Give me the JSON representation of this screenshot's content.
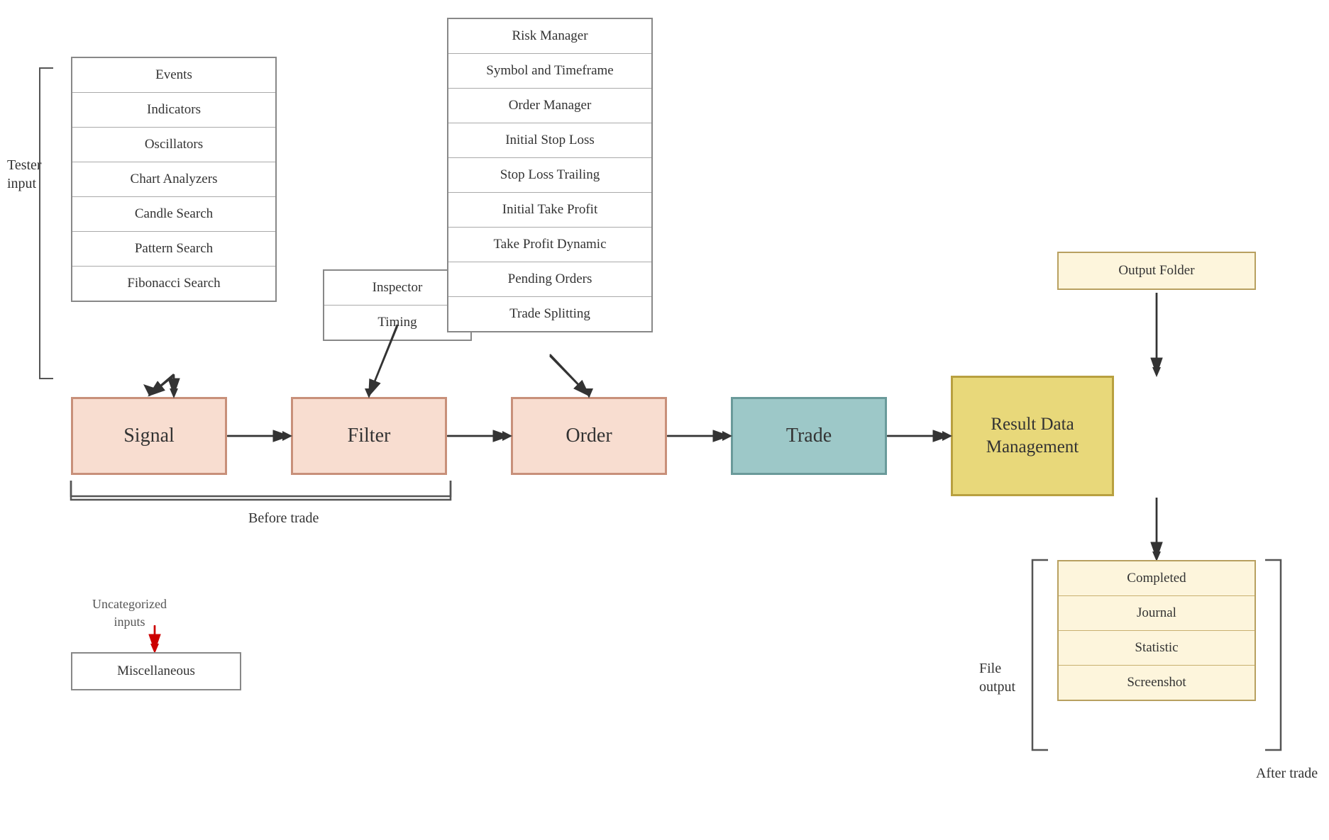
{
  "tester": {
    "label_line1": "Tester",
    "label_line2": "input"
  },
  "input_items": [
    "Events",
    "Indicators",
    "Oscillators",
    "Chart Analyzers",
    "Candle Search",
    "Pattern Search",
    "Fibonacci Search"
  ],
  "filter_items": [
    "Inspector",
    "Timing"
  ],
  "order_items": [
    "Risk Manager",
    "Symbol and Timeframe",
    "Order Manager",
    "Initial Stop Loss",
    "Stop Loss Trailing",
    "Initial Take Profit",
    "Take Profit Dynamic",
    "Pending Orders",
    "Trade Splitting"
  ],
  "process": {
    "signal": "Signal",
    "filter": "Filter",
    "order": "Order",
    "trade": "Trade",
    "rdm": "Result Data Management"
  },
  "before_trade_label": "Before trade",
  "output_folder": "Output Folder",
  "file_output_items": [
    "Completed",
    "Journal",
    "Statistic",
    "Screenshot"
  ],
  "file_output_label_line1": "File",
  "file_output_label_line2": "output",
  "after_trade_label": "After trade",
  "miscellaneous": "Miscellaneous",
  "uncategorized_label_line1": "Uncategorized",
  "uncategorized_label_line2": "inputs"
}
